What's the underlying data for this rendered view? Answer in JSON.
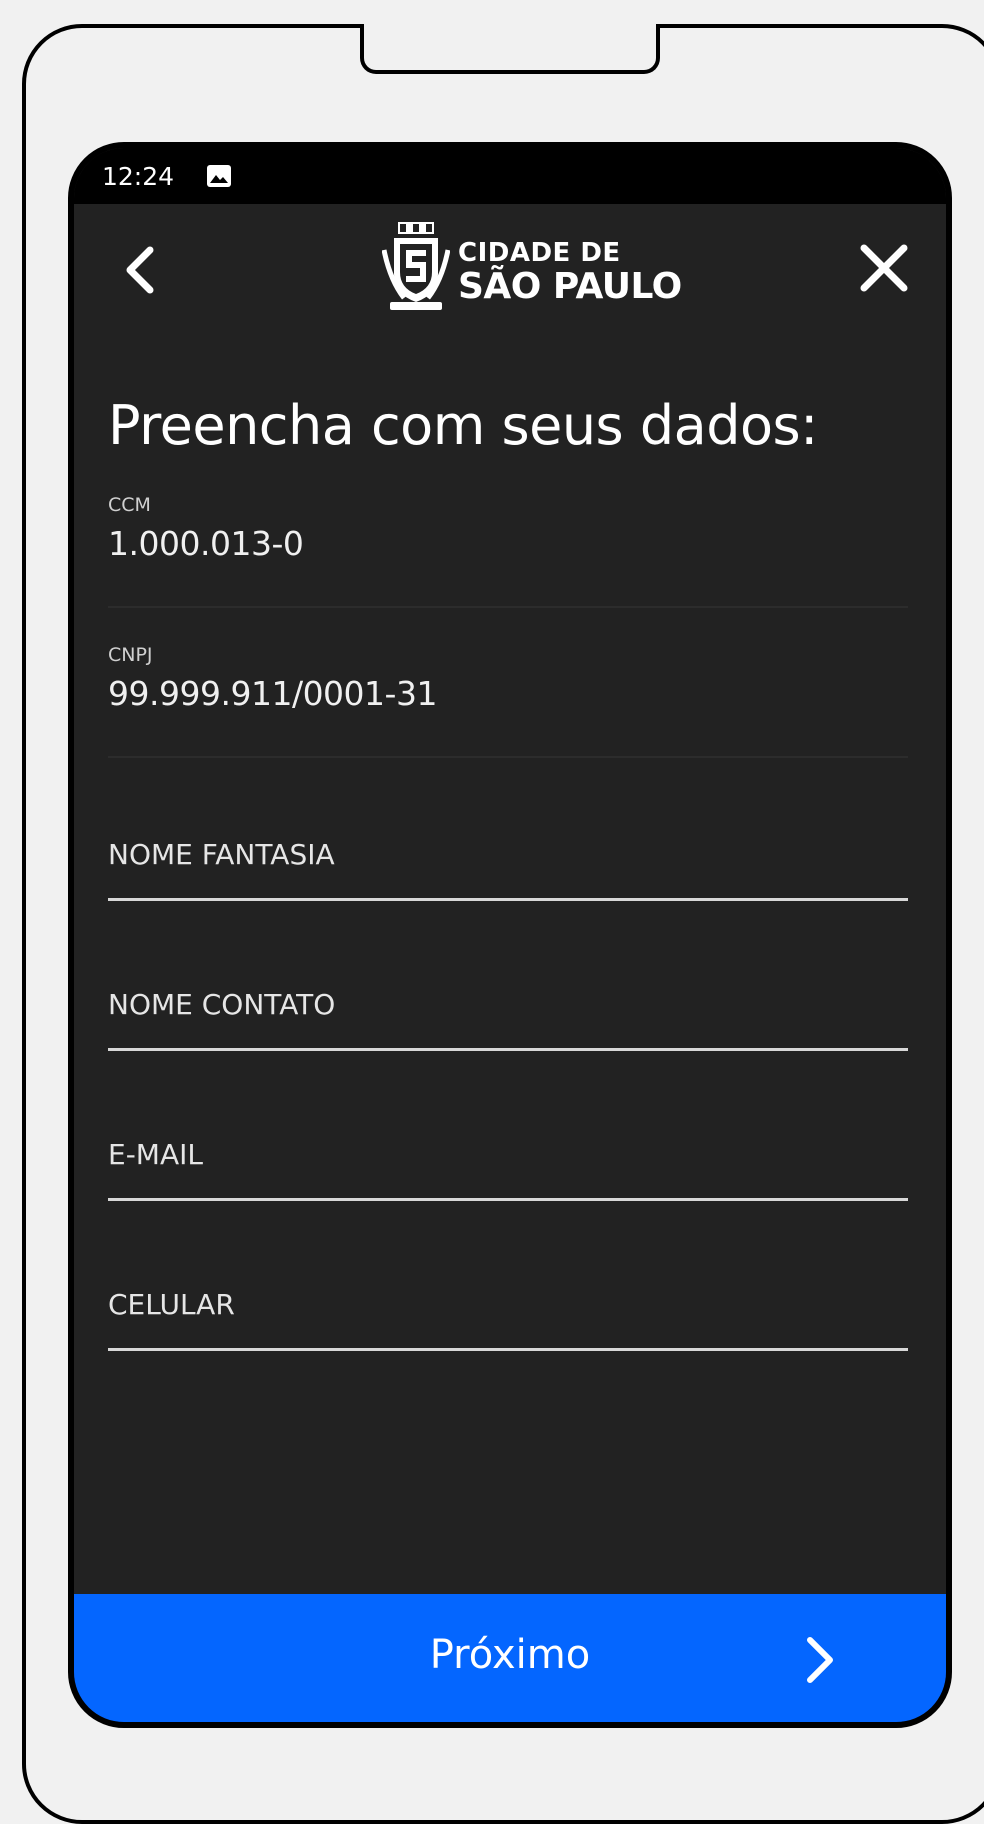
{
  "status_bar": {
    "time": "12:24",
    "notification_icon": "image-icon"
  },
  "header": {
    "back_icon": "chevron-left-icon",
    "close_icon": "close-icon",
    "logo": {
      "crest_icon": "sao-paulo-crest-icon",
      "line1": "CIDADE DE",
      "line2": "SÃO PAULO"
    }
  },
  "form": {
    "title": "Preencha com seus dados:",
    "readonly_fields": [
      {
        "label": "CCM",
        "value": "1.000.013-0"
      },
      {
        "label": "CNPJ",
        "value": "99.999.911/0001-31"
      }
    ],
    "inputs": [
      {
        "placeholder": "NOME FANTASIA",
        "value": ""
      },
      {
        "placeholder": "NOME CONTATO",
        "value": ""
      },
      {
        "placeholder": "E-MAIL",
        "value": ""
      },
      {
        "placeholder": "CELULAR",
        "value": ""
      }
    ]
  },
  "footer": {
    "next_label": "Próximo",
    "next_icon": "chevron-right-icon"
  },
  "colors": {
    "background": "#222222",
    "status_bar": "#000000",
    "primary_button": "#0466ff",
    "text": "#ffffff"
  }
}
